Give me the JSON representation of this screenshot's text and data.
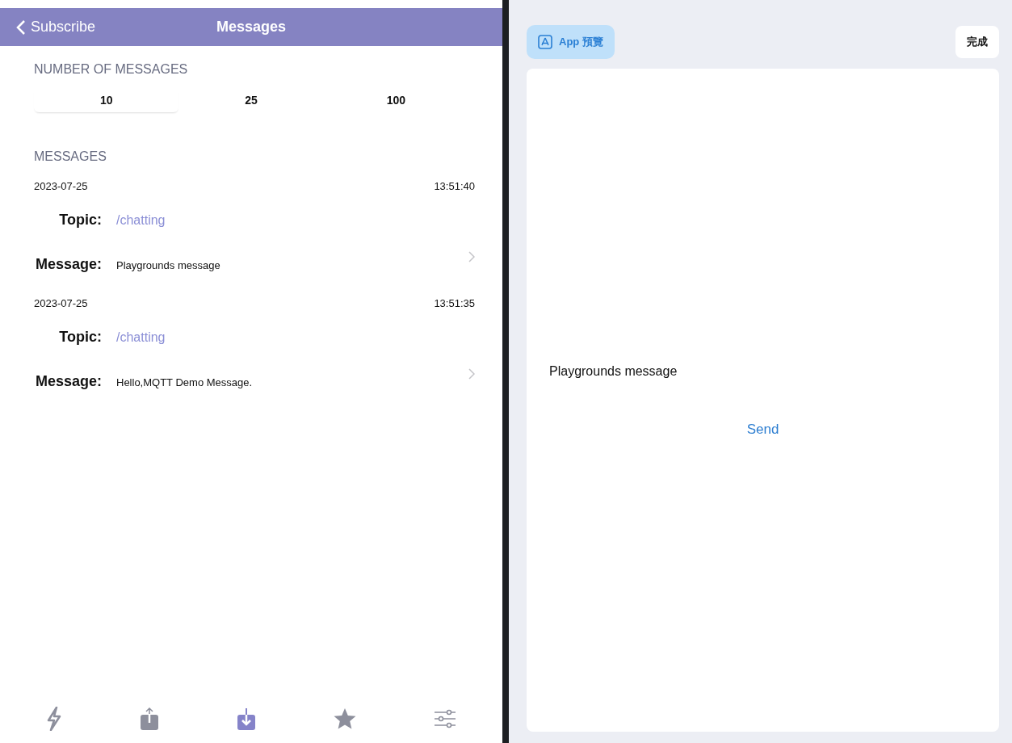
{
  "nav": {
    "back": "Subscribe",
    "title": "Messages"
  },
  "count_section": {
    "header": "NUMBER OF MESSAGES",
    "options": [
      {
        "label": "10",
        "selected": true
      },
      {
        "label": "25",
        "selected": false
      },
      {
        "label": "100",
        "selected": false
      }
    ]
  },
  "messages_section": {
    "header": "MESSAGES",
    "items": [
      {
        "date": "2023-07-25",
        "time": "13:51:40",
        "topic_label": "Topic:",
        "topic": "/chatting",
        "message_label": "Message:",
        "message": "Playgrounds message"
      },
      {
        "date": "2023-07-25",
        "time": "13:51:35",
        "topic_label": "Topic:",
        "topic": "/chatting",
        "message_label": "Message:",
        "message": "Hello,MQTT Demo Message."
      }
    ]
  },
  "tab_bar": [
    {
      "kind": "connect",
      "selected": false
    },
    {
      "kind": "publish",
      "selected": false
    },
    {
      "kind": "subscribe",
      "selected": true
    },
    {
      "kind": "favorites",
      "selected": false
    },
    {
      "kind": "settings",
      "selected": false
    }
  ],
  "preview": {
    "badge": "App 預覽",
    "done": "完成",
    "message": "Playgrounds message",
    "send": "Send"
  }
}
